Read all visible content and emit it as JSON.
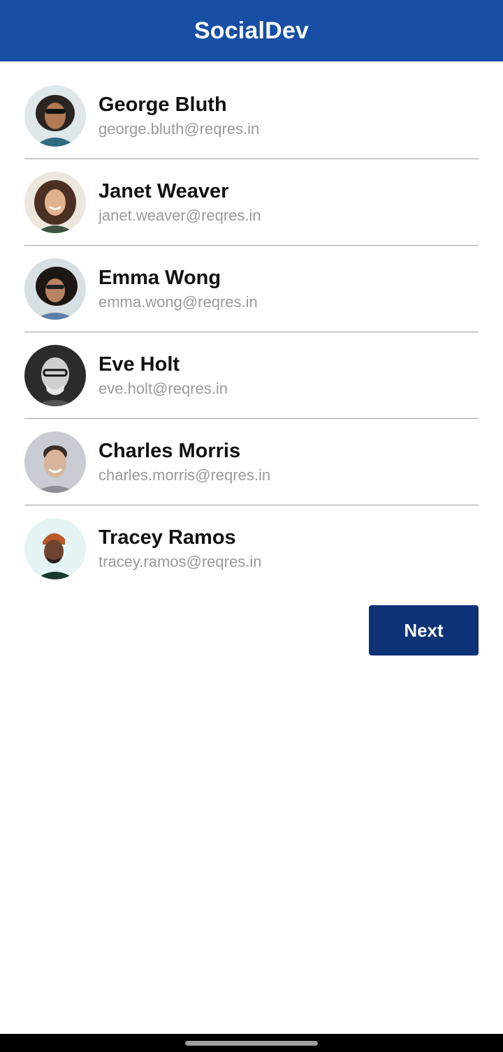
{
  "app": {
    "title": "SocialDev"
  },
  "users": [
    {
      "name": "George Bluth",
      "email": "george.bluth@reqres.in",
      "avatar": "avatar-photo"
    },
    {
      "name": "Janet Weaver",
      "email": "janet.weaver@reqres.in",
      "avatar": "avatar-photo"
    },
    {
      "name": "Emma Wong",
      "email": "emma.wong@reqres.in",
      "avatar": "avatar-photo"
    },
    {
      "name": "Eve Holt",
      "email": "eve.holt@reqres.in",
      "avatar": "avatar-photo"
    },
    {
      "name": "Charles Morris",
      "email": "charles.morris@reqres.in",
      "avatar": "avatar-photo"
    },
    {
      "name": "Tracey Ramos",
      "email": "tracey.ramos@reqres.in",
      "avatar": "avatar-photo"
    }
  ],
  "pagination": {
    "next_label": "Next"
  },
  "colors": {
    "appbar": "#164fa4",
    "button": "#0d3276",
    "divider": "#9e9e9e",
    "email_text": "#9a9a9a"
  }
}
